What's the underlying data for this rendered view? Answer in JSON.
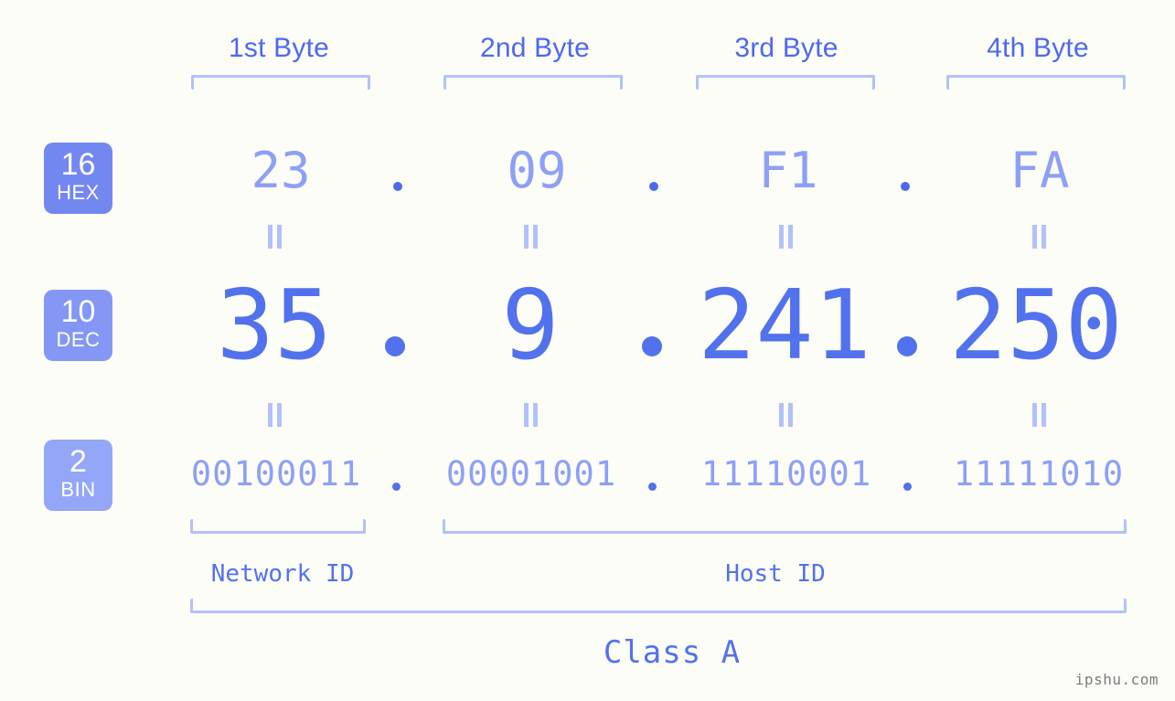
{
  "background_color": "#fcfdf7",
  "accent_color": "#5271ec",
  "accent_light_color": "#8e9ff6",
  "bracket_color": "#b3c0fb",
  "byte_headers": [
    {
      "label": "1st Byte"
    },
    {
      "label": "2nd Byte"
    },
    {
      "label": "3rd Byte"
    },
    {
      "label": "4th Byte"
    }
  ],
  "bases": [
    {
      "number": "16",
      "name": "HEX",
      "color": "#7387f1"
    },
    {
      "number": "10",
      "name": "DEC",
      "color": "#8497f4"
    },
    {
      "number": "2",
      "name": "BIN",
      "color": "#93a6f7"
    }
  ],
  "rows": {
    "hex": {
      "values": [
        "23",
        "09",
        "F1",
        "FA"
      ],
      "separator": "."
    },
    "dec": {
      "values": [
        "35",
        "9",
        "241",
        "250"
      ],
      "separator": "."
    },
    "bin": {
      "values": [
        "00100011",
        "00001001",
        "11110001",
        "11111010"
      ],
      "separator": "."
    }
  },
  "equals_marks": {
    "symbol": "=",
    "count_per_row": 4,
    "rows": 2
  },
  "segments": {
    "network_id": {
      "label": "Network ID"
    },
    "host_id": {
      "label": "Host ID"
    },
    "class": {
      "label": "Class A"
    }
  },
  "watermark": {
    "text": "ipshu.com"
  }
}
